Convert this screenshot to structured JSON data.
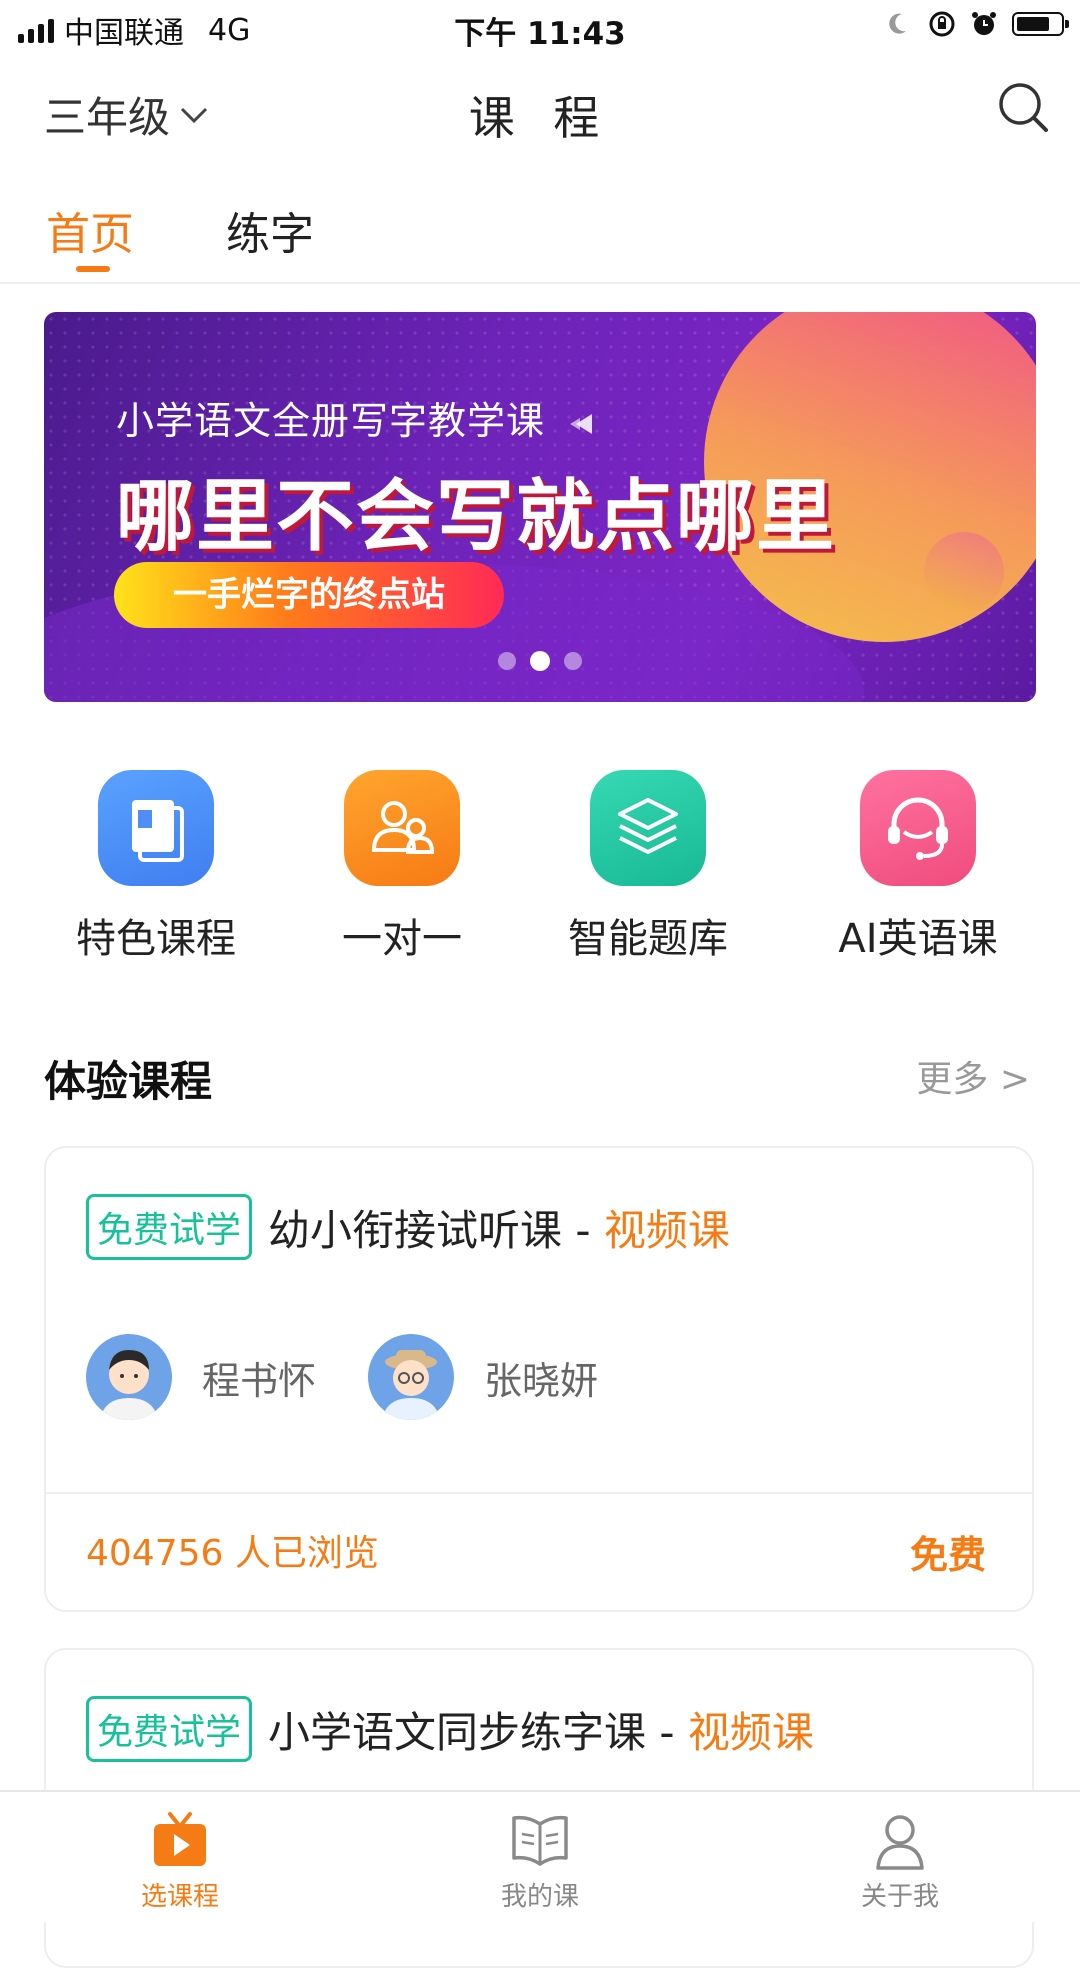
{
  "status_bar": {
    "carrier": "中国联通",
    "network": "4G",
    "time": "下午 11:43"
  },
  "header": {
    "grade_selector": "三年级",
    "title": "课 程"
  },
  "tabs": [
    {
      "label": "首页",
      "active": true
    },
    {
      "label": "练字",
      "active": false
    }
  ],
  "banner": {
    "subtitle": "小学语文全册写字教学课",
    "slogan": "哪里不会写就点哪里",
    "pill_text": "一手烂字的终点站",
    "carousel_total": 3,
    "carousel_active": 2
  },
  "entries": [
    {
      "label": "特色课程",
      "icon": "book-icon",
      "color": "#4f8ef7"
    },
    {
      "label": "一对一",
      "icon": "users-icon",
      "color": "#f98b1f"
    },
    {
      "label": "智能题库",
      "icon": "layers-icon",
      "color": "#22c9a6"
    },
    {
      "label": "AI英语课",
      "icon": "headset-icon",
      "color": "#f25c8a"
    }
  ],
  "section": {
    "title": "体验课程",
    "more": "更多 >"
  },
  "courses": [
    {
      "tag": "免费试学",
      "title": "幼小衔接试听课 - ",
      "type": "视频课",
      "teachers": [
        "程书怀",
        "张晓妍"
      ],
      "views": "404756 人已浏览",
      "price": "免费"
    },
    {
      "tag": "免费试学",
      "title": "小学语文同步练字课 - ",
      "type": "视频课"
    }
  ],
  "bottom_nav": [
    {
      "label": "选课程",
      "icon": "play-tv-icon",
      "active": true
    },
    {
      "label": "我的课",
      "icon": "open-book-icon",
      "active": false
    },
    {
      "label": "关于我",
      "icon": "person-icon",
      "active": false
    }
  ],
  "colors": {
    "accent": "#f57c14",
    "free_tag": "#17c29a"
  }
}
